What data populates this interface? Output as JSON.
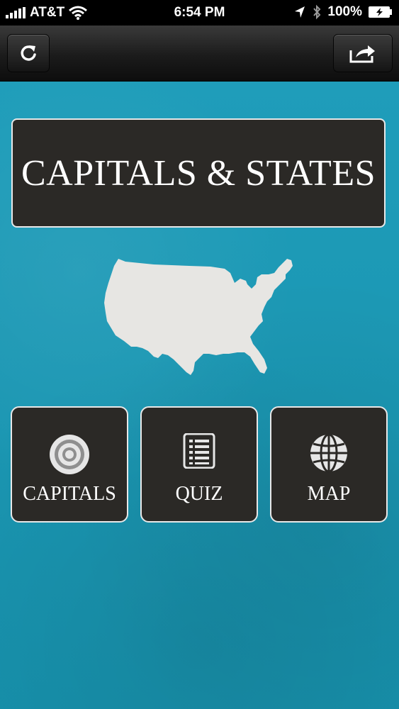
{
  "status_bar": {
    "carrier": "AT&T",
    "time": "6:54 PM",
    "battery": "100%"
  },
  "nav": {
    "left_icon": "refresh-icon",
    "right_icon": "share-icon"
  },
  "title": "CAPITALS & STATES",
  "tiles": [
    {
      "label": "CAPITALS",
      "icon": "target-icon"
    },
    {
      "label": "QUIZ",
      "icon": "list-icon"
    },
    {
      "label": "MAP",
      "icon": "globe-icon"
    }
  ],
  "colors": {
    "background": "#1e9bb6",
    "panel": "#2b2926",
    "border": "#e8e8e8"
  }
}
